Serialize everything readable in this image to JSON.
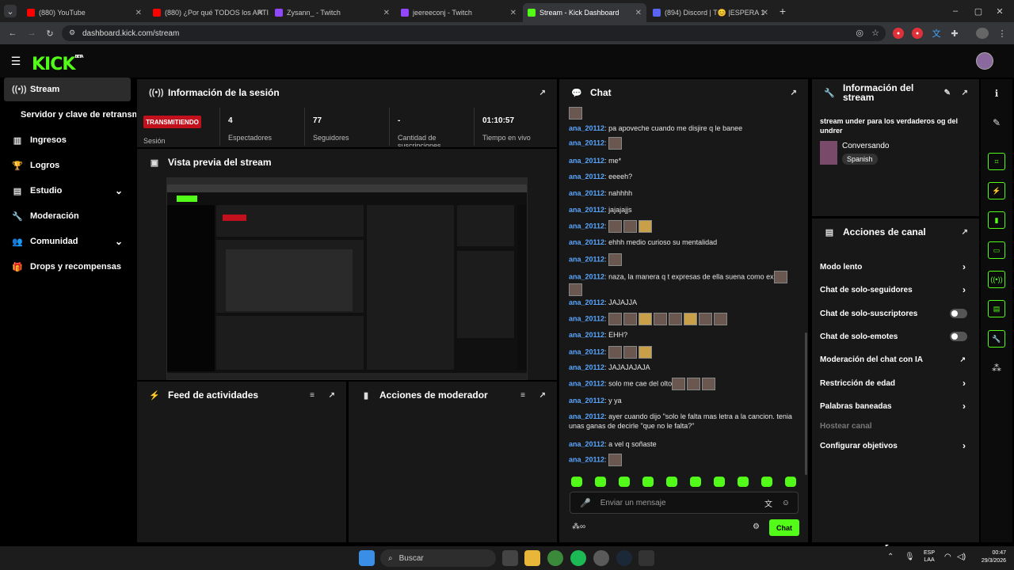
{
  "browser": {
    "tabs": [
      {
        "title": "(880) YouTube",
        "color": "#ff0000"
      },
      {
        "title": "(880) ¿Por qué TODOS los ARTI",
        "color": "#ff0000"
      },
      {
        "title": "Zysann_ - Twitch",
        "color": "#9146ff"
      },
      {
        "title": "jeereeconj - Twitch",
        "color": "#9146ff"
      },
      {
        "title": "Stream - Kick Dashboard",
        "color": "#53fc18"
      },
      {
        "title": "(894) Discord | T😊 |ESPERA 1",
        "color": "#5865f2"
      }
    ],
    "new_tab": "+",
    "url": "dashboard.kick.com/stream",
    "window_controls": [
      "–",
      "▢",
      "✕"
    ]
  },
  "kick": {
    "logo": "KICK",
    "logo_badge": "BETA",
    "brand_color": "#53fc18"
  },
  "sidebar": {
    "items": [
      {
        "label": "Stream",
        "icon": "broadcast-icon",
        "glyph": "((•))",
        "active": true
      },
      {
        "label": "Servidor y clave de retransmisión",
        "icon": "",
        "glyph": "",
        "active": false
      },
      {
        "label": "Ingresos",
        "icon": "chart-icon",
        "glyph": "▥",
        "active": false
      },
      {
        "label": "Logros",
        "icon": "trophy-icon",
        "glyph": "🏆",
        "active": false
      },
      {
        "label": "Estudio",
        "icon": "studio-icon",
        "glyph": "▤",
        "active": false,
        "chevron": "⌄"
      },
      {
        "label": "Moderación",
        "icon": "wrench-icon",
        "glyph": "🔧",
        "active": false
      },
      {
        "label": "Comunidad",
        "icon": "community-icon",
        "glyph": "👥",
        "active": false,
        "chevron": "⌄"
      },
      {
        "label": "Drops y recompensas",
        "icon": "gift-icon",
        "glyph": "🎁",
        "active": false
      }
    ]
  },
  "session": {
    "title": "Información de la sesión",
    "status_badge": "TRANSMITIENDO",
    "status_label": "Sesión",
    "stats": [
      {
        "value": "4",
        "label": "Espectadores"
      },
      {
        "value": "77",
        "label": "Seguidores"
      },
      {
        "value": "-",
        "label": "Cantidad de suscripciones"
      },
      {
        "value": "01:10:57",
        "label": "Tiempo en vivo"
      }
    ]
  },
  "preview": {
    "title": "Vista previa del stream"
  },
  "activity_feed": {
    "title": "Feed de actividades"
  },
  "mod_actions": {
    "title": "Acciones de moderador"
  },
  "chat": {
    "title": "Chat",
    "messages": [
      {
        "user": "",
        "text": "",
        "emotes": 1
      },
      {
        "user": "ana_20112",
        "text": "pa apoveche cuando me disjire q le banee",
        "emotes": 0
      },
      {
        "user": "ana_20112",
        "text": "",
        "emotes": 1
      },
      {
        "user": "ana_20112",
        "text": "me*",
        "emotes": 0
      },
      {
        "user": "ana_20112",
        "text": "eeeeh?",
        "emotes": 0
      },
      {
        "user": "ana_20112",
        "text": "nahhhh",
        "emotes": 0
      },
      {
        "user": "ana_20112",
        "text": "jajajajjs",
        "emotes": 0
      },
      {
        "user": "ana_20112",
        "text": "",
        "emotes": 3
      },
      {
        "user": "ana_20112",
        "text": "ehhh medio curioso su mentalidad",
        "emotes": 0
      },
      {
        "user": "ana_20112",
        "text": "",
        "emotes": 1
      },
      {
        "user": "ana_20112",
        "text": "naza, la manera q t expresas de ella suena como ex",
        "emotes": 2
      },
      {
        "user": "ana_20112",
        "text": "JAJAJJA",
        "emotes": 0
      },
      {
        "user": "ana_20112",
        "text": "",
        "emotes": 8
      },
      {
        "user": "ana_20112",
        "text": "EHH?",
        "emotes": 0
      },
      {
        "user": "ana_20112",
        "text": "",
        "emotes": 3
      },
      {
        "user": "ana_20112",
        "text": "JAJAJAJAJA",
        "emotes": 0
      },
      {
        "user": "ana_20112",
        "text": "solo me cae del olto",
        "emotes": 3
      },
      {
        "user": "ana_20112",
        "text": "y ya",
        "emotes": 0
      },
      {
        "user": "ana_20112",
        "text": "ayer cuando dijo \"solo le falta mas letra a la cancion. tenia unas ganas de decirle \"que no le falta?\"",
        "emotes": 0
      },
      {
        "user": "ana_20112",
        "text": "a vel q soñaste",
        "emotes": 0
      },
      {
        "user": "ana_20112",
        "text": "",
        "emotes": 1
      }
    ],
    "input_placeholder": "Enviar un mensaje",
    "send_label": "Chat"
  },
  "stream_info": {
    "title": "Información del stream",
    "stream_title": "stream under para los verdaderos og del undrer",
    "category": "Conversando",
    "language_tag": "Spanish"
  },
  "channel_actions": {
    "title": "Acciones de canal",
    "rows": [
      {
        "label": "Modo lento",
        "control": "chevron"
      },
      {
        "label": "Chat de solo-seguidores",
        "control": "chevron"
      },
      {
        "label": "Chat de solo-suscriptores",
        "control": "toggle"
      },
      {
        "label": "Chat de solo-emotes",
        "control": "toggle"
      },
      {
        "label": "Moderación del chat con IA",
        "control": "external"
      },
      {
        "label": "Restricción de edad",
        "control": "chevron"
      },
      {
        "label": "Palabras baneadas",
        "control": "chevron"
      },
      {
        "label": "Hostear canal",
        "control": "none",
        "disabled": true
      },
      {
        "label": "Configurar objetivos",
        "control": "chevron"
      }
    ]
  },
  "taskbar": {
    "search_placeholder": "Buscar",
    "lang": "ESP",
    "lang2": "LAA",
    "time": "00:47",
    "date": "29/3/2026"
  }
}
